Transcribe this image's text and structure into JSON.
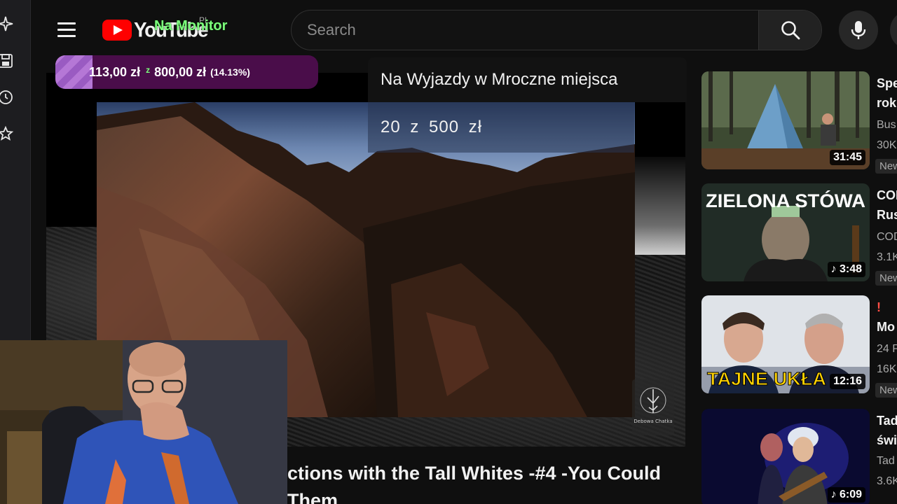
{
  "app": {
    "brand": "YouTube",
    "country": "PL",
    "monitor_label": "Na Monitor"
  },
  "left_bar": {
    "icons": [
      "sparkle-icon",
      "save-icon",
      "history-icon",
      "star-icon"
    ]
  },
  "search": {
    "placeholder": "Search"
  },
  "goal": {
    "current": "113,00 zł",
    "separator": "z",
    "target": "800,00 zł",
    "percent_label": "(14.13%)",
    "progress_fraction": 0.1413
  },
  "donation_alert": {
    "title": "Na Wyjazdy w Mroczne miejsca",
    "amount": "20 z 500 zł"
  },
  "video": {
    "title_line1": "ctions with the Tall Whites -#4 -You Could",
    "title_line2": "Them",
    "watermark_text": "Debowa Chatka"
  },
  "recommendations": [
    {
      "title": "Spe",
      "title2": "rok",
      "channel": "Bus",
      "views": "30K",
      "badge": "New",
      "duration": "31:45",
      "thumb": "tent-forest"
    },
    {
      "title": "COI",
      "title2": "Rus",
      "channel": "COD",
      "views": "3.1K",
      "badge": "New",
      "duration": "3:48",
      "thumb_text": "ZIELONA STÓWA",
      "music": true
    },
    {
      "title": "!",
      "title2": "Mo",
      "channel": "24 P",
      "views": "16K",
      "badge": "New",
      "duration": "12:16",
      "thumb_text": "TAJNE UKŁA"
    },
    {
      "title": "Tad",
      "title2": "świ",
      "channel": "Tad",
      "views": "3.6K",
      "duration": "6:09",
      "music": true
    }
  ]
}
